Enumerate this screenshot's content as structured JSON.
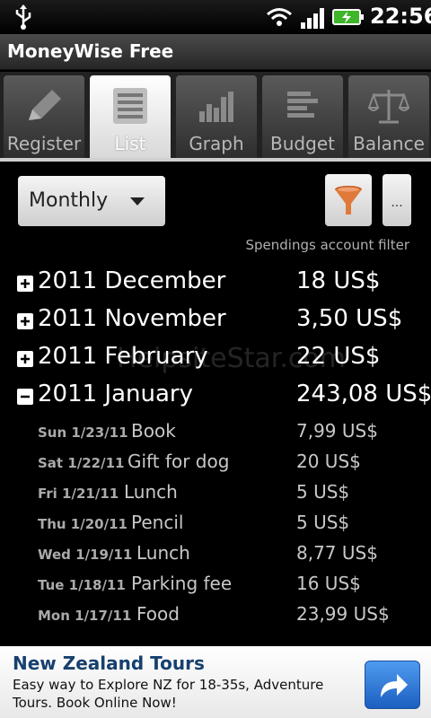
{
  "statusbar": {
    "time": "22:56"
  },
  "app": {
    "title": "MoneyWise Free"
  },
  "tabs": [
    {
      "label": "Register",
      "icon": "pencil-icon",
      "active": false
    },
    {
      "label": "List",
      "icon": "list-icon",
      "active": true
    },
    {
      "label": "Graph",
      "icon": "bar-chart-icon",
      "active": false
    },
    {
      "label": "Budget",
      "icon": "budget-bars-icon",
      "active": false
    },
    {
      "label": "Balance",
      "icon": "scales-icon",
      "active": false
    }
  ],
  "controls": {
    "period_value": "Monthly",
    "more_label": "...",
    "filter_caption": "Spendings account filter",
    "filter_icon_color": "#e07a3a"
  },
  "months": [
    {
      "label": "2011 December",
      "amount": "18 US$",
      "expanded": false
    },
    {
      "label": "2011 November",
      "amount": "3,50 US$",
      "expanded": false
    },
    {
      "label": "2011 February",
      "amount": "22 US$",
      "expanded": false
    },
    {
      "label": "2011 January",
      "amount": "243,08 US$",
      "expanded": true
    }
  ],
  "transactions": [
    {
      "date": "Sun 1/23/11",
      "desc": "Book",
      "amount": "7,99 US$"
    },
    {
      "date": "Sat 1/22/11",
      "desc": "Gift for dog",
      "amount": "20 US$"
    },
    {
      "date": "Fri 1/21/11",
      "desc": "Lunch",
      "amount": "5 US$"
    },
    {
      "date": "Thu 1/20/11",
      "desc": "Pencil",
      "amount": "5 US$"
    },
    {
      "date": "Wed 1/19/11",
      "desc": "Lunch",
      "amount": "8,77 US$"
    },
    {
      "date": "Tue 1/18/11",
      "desc": "Parking fee",
      "amount": "16 US$"
    },
    {
      "date": "Mon 1/17/11",
      "desc": "Food",
      "amount": "23,99 US$"
    }
  ],
  "watermark": "HelpsiteStar.com",
  "ad": {
    "title": "New Zealand Tours",
    "text": "Easy way to Explore NZ for 18-35s, Adventure Tours. Book Online Now!"
  }
}
